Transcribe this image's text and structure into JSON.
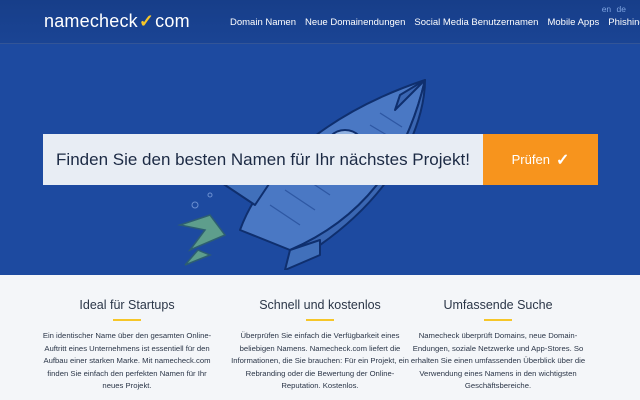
{
  "brand": {
    "name_part1": "namecheck",
    "check_symbol": "✓",
    "name_part2": "com"
  },
  "nav": {
    "items": [
      {
        "label": "Domain Namen"
      },
      {
        "label": "Neue Domainendungen"
      },
      {
        "label": "Social Media Benutzernamen"
      },
      {
        "label": "Mobile Apps"
      },
      {
        "label": "PhishingCheck"
      }
    ]
  },
  "lang": {
    "en": "en",
    "de": "de"
  },
  "search": {
    "placeholder": "Finden Sie den besten Namen für Ihr nächstes Projekt!",
    "button_label": "Prüfen",
    "button_check": "✓"
  },
  "features": [
    {
      "title": "Ideal für Startups",
      "text": "Ein identischer Name über den gesamten Online-Auftritt eines Unternehmens ist essentiell für den Aufbau einer starken Marke. Mit namecheck.com finden Sie einfach den perfekten Namen für Ihr neues Projekt."
    },
    {
      "title": "Schnell und kostenlos",
      "text": "Überprüfen Sie einfach die Verfügbarkeit eines beliebigen Namens. Namecheck.com liefert die Informationen, die Sie brauchen: Für ein Projekt, ein Rebranding oder die Bewertung der Online-Reputation. Kostenlos."
    },
    {
      "title": "Umfassende Suche",
      "text": "Namecheck überprüft Domains, neue Domain-Endungen, soziale Netzwerke und App-Stores. So erhalten Sie einen umfassenden Überblick über die Verwendung eines Namens in den wichtigsten Geschäftsbereiche."
    }
  ],
  "colors": {
    "hero_blue": "#1d4aa0",
    "accent_orange": "#f7941d",
    "accent_yellow": "#f6c629",
    "input_bg": "#e8edf4"
  },
  "icons": {
    "hero_illustration": "rocket-icon"
  }
}
